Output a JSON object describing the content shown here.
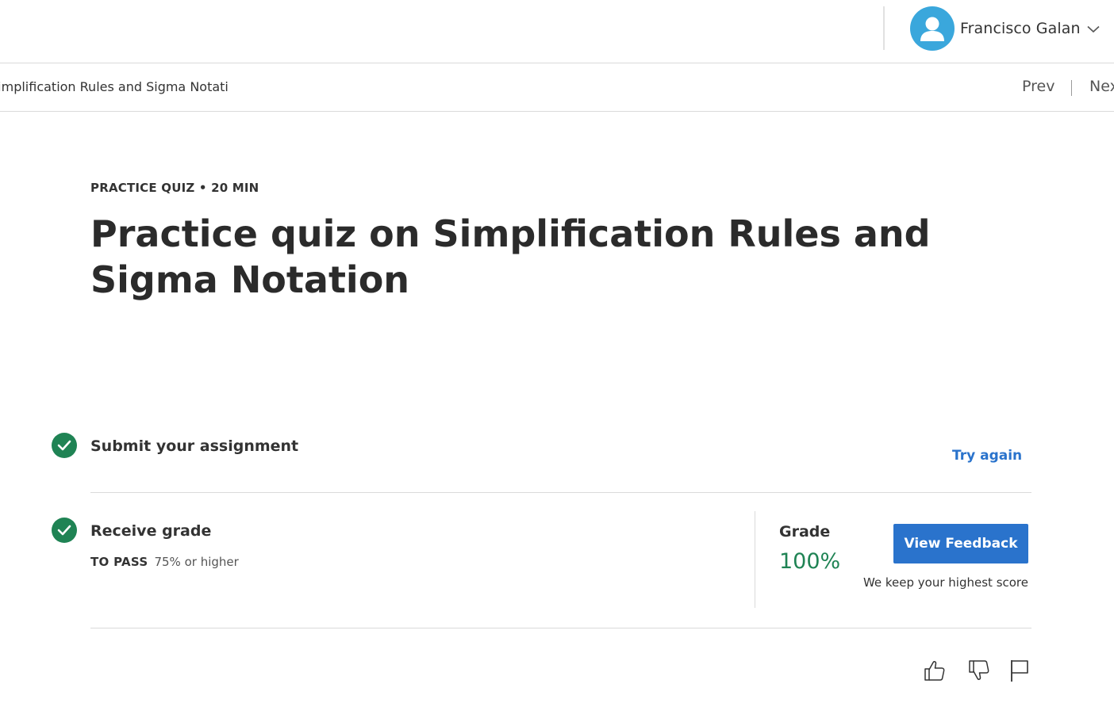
{
  "header": {
    "user_name": "Francisco Galan"
  },
  "nav": {
    "breadcrumb": "Simplification Rules and Sigma Notati",
    "prev_label": "Prev",
    "next_label": "Next"
  },
  "quiz": {
    "eyebrow": "PRACTICE QUIZ • 20 MIN",
    "title": "Practice quiz on Simplification Rules and Sigma Notation"
  },
  "steps": {
    "submit": {
      "title": "Submit your assignment",
      "action_label": "Try again"
    },
    "grade": {
      "title": "Receive grade",
      "to_pass_label": "TO PASS",
      "to_pass_value": "75% or higher",
      "grade_label": "Grade",
      "grade_value": "100%",
      "button_label": "View Feedback",
      "note": "We keep your highest score"
    }
  },
  "icons": {
    "avatar": "user-avatar-icon",
    "dropdown": "chevron-down-icon",
    "step_done": "check-circle-icon",
    "like": "thumbs-up-icon",
    "dislike": "thumbs-down-icon",
    "report": "flag-icon"
  },
  "colors": {
    "accent_blue": "#2a73cc",
    "success_green": "#1f8354",
    "avatar_blue": "#3aa7dc"
  }
}
